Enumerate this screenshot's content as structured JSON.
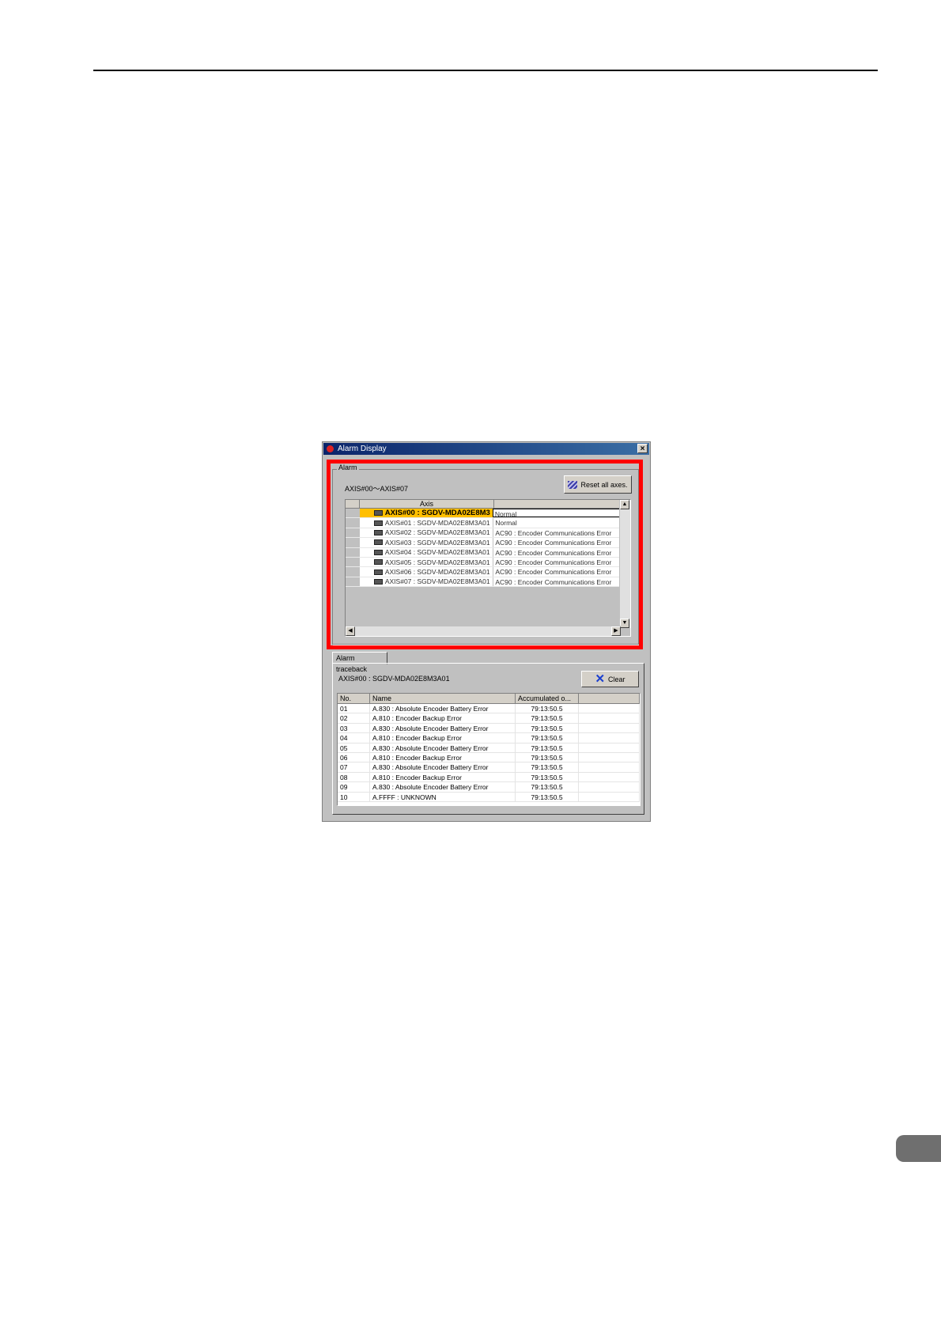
{
  "window": {
    "title": "Alarm Display",
    "close_label": "×"
  },
  "alarm": {
    "group_label": "Alarm",
    "axis_range": "AXIS#00～AXIS#07",
    "reset_button": "Reset all axes.",
    "columns": [
      "Axis",
      ""
    ],
    "rows": [
      {
        "axis": "AXIS#00 : SGDV-MDA02E8M3",
        "status": "Normal"
      },
      {
        "axis": "AXIS#01 : SGDV-MDA02E8M3A01",
        "status": "Normal"
      },
      {
        "axis": "AXIS#02 : SGDV-MDA02E8M3A01",
        "status": "AC90 : Encoder Communications Error"
      },
      {
        "axis": "AXIS#03 : SGDV-MDA02E8M3A01",
        "status": "AC90 : Encoder Communications Error"
      },
      {
        "axis": "AXIS#04 : SGDV-MDA02E8M3A01",
        "status": "AC90 : Encoder Communications Error"
      },
      {
        "axis": "AXIS#05 : SGDV-MDA02E8M3A01",
        "status": "AC90 : Encoder Communications Error"
      },
      {
        "axis": "AXIS#06 : SGDV-MDA02E8M3A01",
        "status": "AC90 : Encoder Communications Error"
      },
      {
        "axis": "AXIS#07 : SGDV-MDA02E8M3A01",
        "status": "AC90 : Encoder Communications Error"
      }
    ]
  },
  "traceback": {
    "tab_label": "Alarm traceback",
    "axis_label": "AXIS#00 : SGDV-MDA02E8M3A01",
    "clear_button": "Clear",
    "columns": [
      "No.",
      "Name",
      "Accumulated o...",
      ""
    ],
    "rows": [
      {
        "no": "01",
        "name": "A.830 : Absolute Encoder Battery Error",
        "time": "79:13:50.5"
      },
      {
        "no": "02",
        "name": "A.810 : Encoder Backup Error",
        "time": "79:13:50.5"
      },
      {
        "no": "03",
        "name": "A.830 : Absolute Encoder Battery Error",
        "time": "79:13:50.5"
      },
      {
        "no": "04",
        "name": "A.810 : Encoder Backup Error",
        "time": "79:13:50.5"
      },
      {
        "no": "05",
        "name": "A.830 : Absolute Encoder Battery Error",
        "time": "79:13:50.5"
      },
      {
        "no": "06",
        "name": "A.810 : Encoder Backup Error",
        "time": "79:13:50.5"
      },
      {
        "no": "07",
        "name": "A.830 : Absolute Encoder Battery Error",
        "time": "79:13:50.5"
      },
      {
        "no": "08",
        "name": "A.810 : Encoder Backup Error",
        "time": "79:13:50.5"
      },
      {
        "no": "09",
        "name": "A.830 : Absolute Encoder Battery Error",
        "time": "79:13:50.5"
      },
      {
        "no": "10",
        "name": "A.FFFF : UNKNOWN",
        "time": "79:13:50.5"
      }
    ]
  },
  "icons": {
    "title": "alarm-app-icon",
    "reset": "reset-axes-icon",
    "clear": "clear-x-icon",
    "row": "servo-node-icon"
  },
  "colors": {
    "highlight": "#ff0000",
    "selected_row": "#ffbf00",
    "titlebar": "#0a246a"
  }
}
